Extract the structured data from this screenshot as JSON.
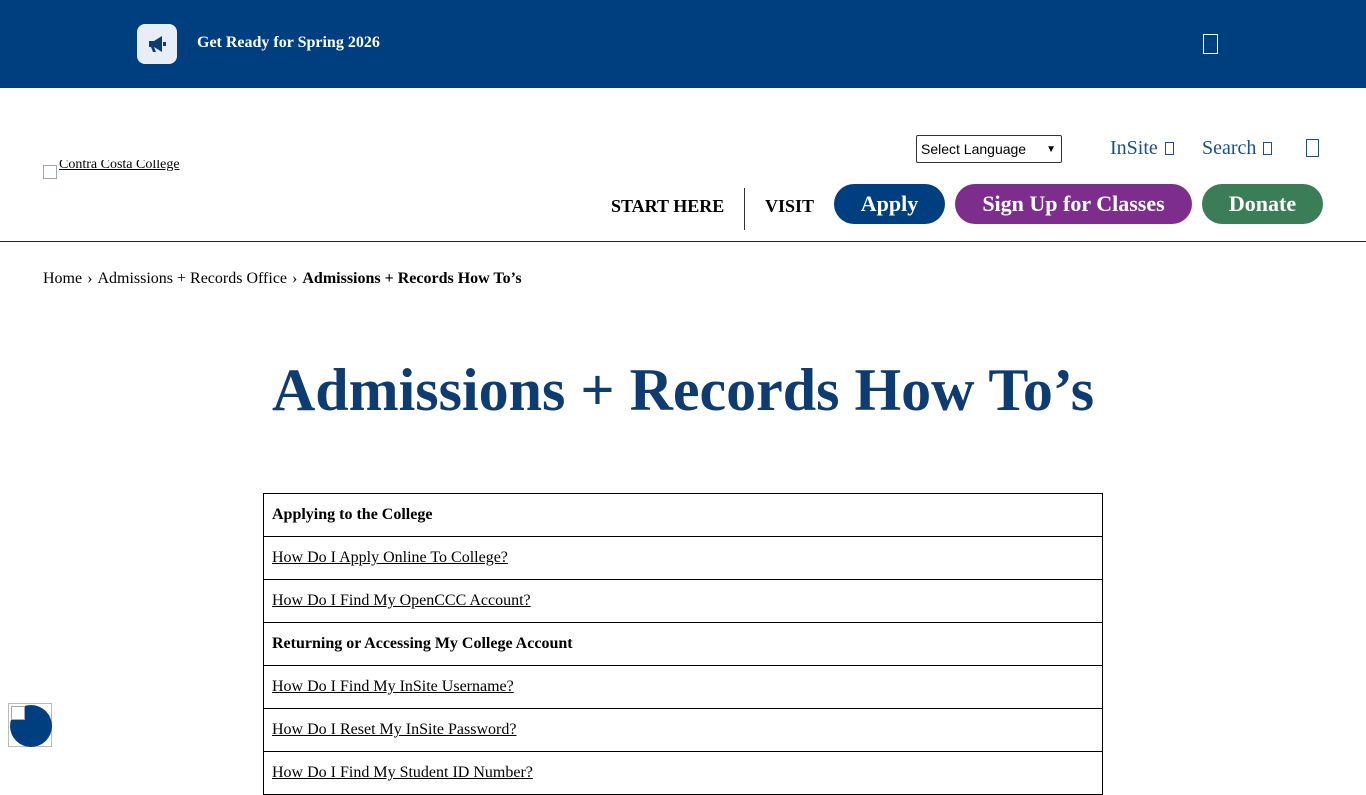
{
  "alert": {
    "icon": "megaphone-icon",
    "text": "Get Ready for Spring 2026",
    "close_icon": "close-icon"
  },
  "header": {
    "logo_alt": "Contra Costa College",
    "language_select": {
      "selected": "Select Language",
      "options": [
        "Select Language"
      ]
    },
    "utility_links": [
      {
        "label": "InSite",
        "icon": "external-link-icon"
      },
      {
        "label": "Search",
        "icon": "search-icon"
      }
    ],
    "menu_icon": "menu-icon",
    "nav_links": [
      "START HERE",
      "VISIT"
    ],
    "buttons": [
      {
        "label": "Apply",
        "color": "#003f7f"
      },
      {
        "label": "Sign Up for Classes",
        "color": "#7d2e8c"
      },
      {
        "label": "Donate",
        "color": "#3b7d57"
      }
    ]
  },
  "breadcrumb": {
    "items": [
      "Home",
      "Admissions + Records Office"
    ],
    "separator": "›",
    "current": "Admissions + Records How To’s"
  },
  "page_title": "Admissions + Records How To’s",
  "table": {
    "rows": [
      {
        "type": "section",
        "text": "Applying to the College"
      },
      {
        "type": "link",
        "text": "How Do I Apply Online To College?"
      },
      {
        "type": "link",
        "text": "How Do I Find My OpenCCC Account?"
      },
      {
        "type": "section",
        "text": "Returning or Accessing My College Account"
      },
      {
        "type": "link",
        "text": "How Do I Find My InSite Username?"
      },
      {
        "type": "link",
        "text": "How Do I Reset My InSite Password?"
      },
      {
        "type": "link",
        "text": "How Do I Find My Student ID Number?"
      }
    ]
  },
  "accessibility_widget": {
    "icon": "accessibility-icon"
  },
  "colors": {
    "brand_blue": "#003f7f",
    "title_blue": "#0f3c70",
    "link_blue": "#1a4f8a"
  }
}
